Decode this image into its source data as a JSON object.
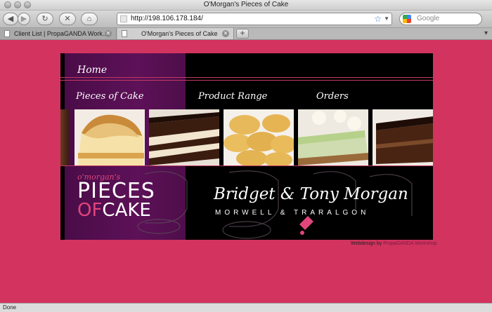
{
  "window": {
    "title": "O'Morgan's Pieces of Cake"
  },
  "toolbar": {
    "back_icon": "back-arrow-icon",
    "forward_icon": "forward-arrow-icon",
    "reload_icon": "reload-icon",
    "stop_icon": "stop-icon",
    "home_icon": "home-icon",
    "url": "http://198.106.178.184/",
    "search_placeholder": "Google"
  },
  "tabs": [
    {
      "label": "Client List | PropaGANDA Work...",
      "active": false
    },
    {
      "label": "O'Morgan's Pieces of Cake",
      "active": true
    }
  ],
  "site": {
    "menu": {
      "home": "Home"
    },
    "nav": [
      "Pieces of Cake",
      "Product Range",
      "Orders"
    ],
    "photos": [
      "lemon-meringue-pie",
      "chocolate-layer-cake",
      "yo-yo-biscuits",
      "lime-cheesecake",
      "chocolate-cake-slice"
    ],
    "logo": {
      "small": "o'morgan's",
      "pieces": "PIECES",
      "of": "OF",
      "cake": "CAKE"
    },
    "owners": "Bridget & Tony Morgan",
    "towns": "MORWELL   &   TRARALGON",
    "credit": {
      "prefix": "Webdesign by",
      "studio": "PropaGANDA Workshop"
    },
    "colors": {
      "background": "#d2335f",
      "purple": "#5d1158",
      "pink": "#e0457b"
    }
  },
  "status": {
    "text": "Done"
  }
}
